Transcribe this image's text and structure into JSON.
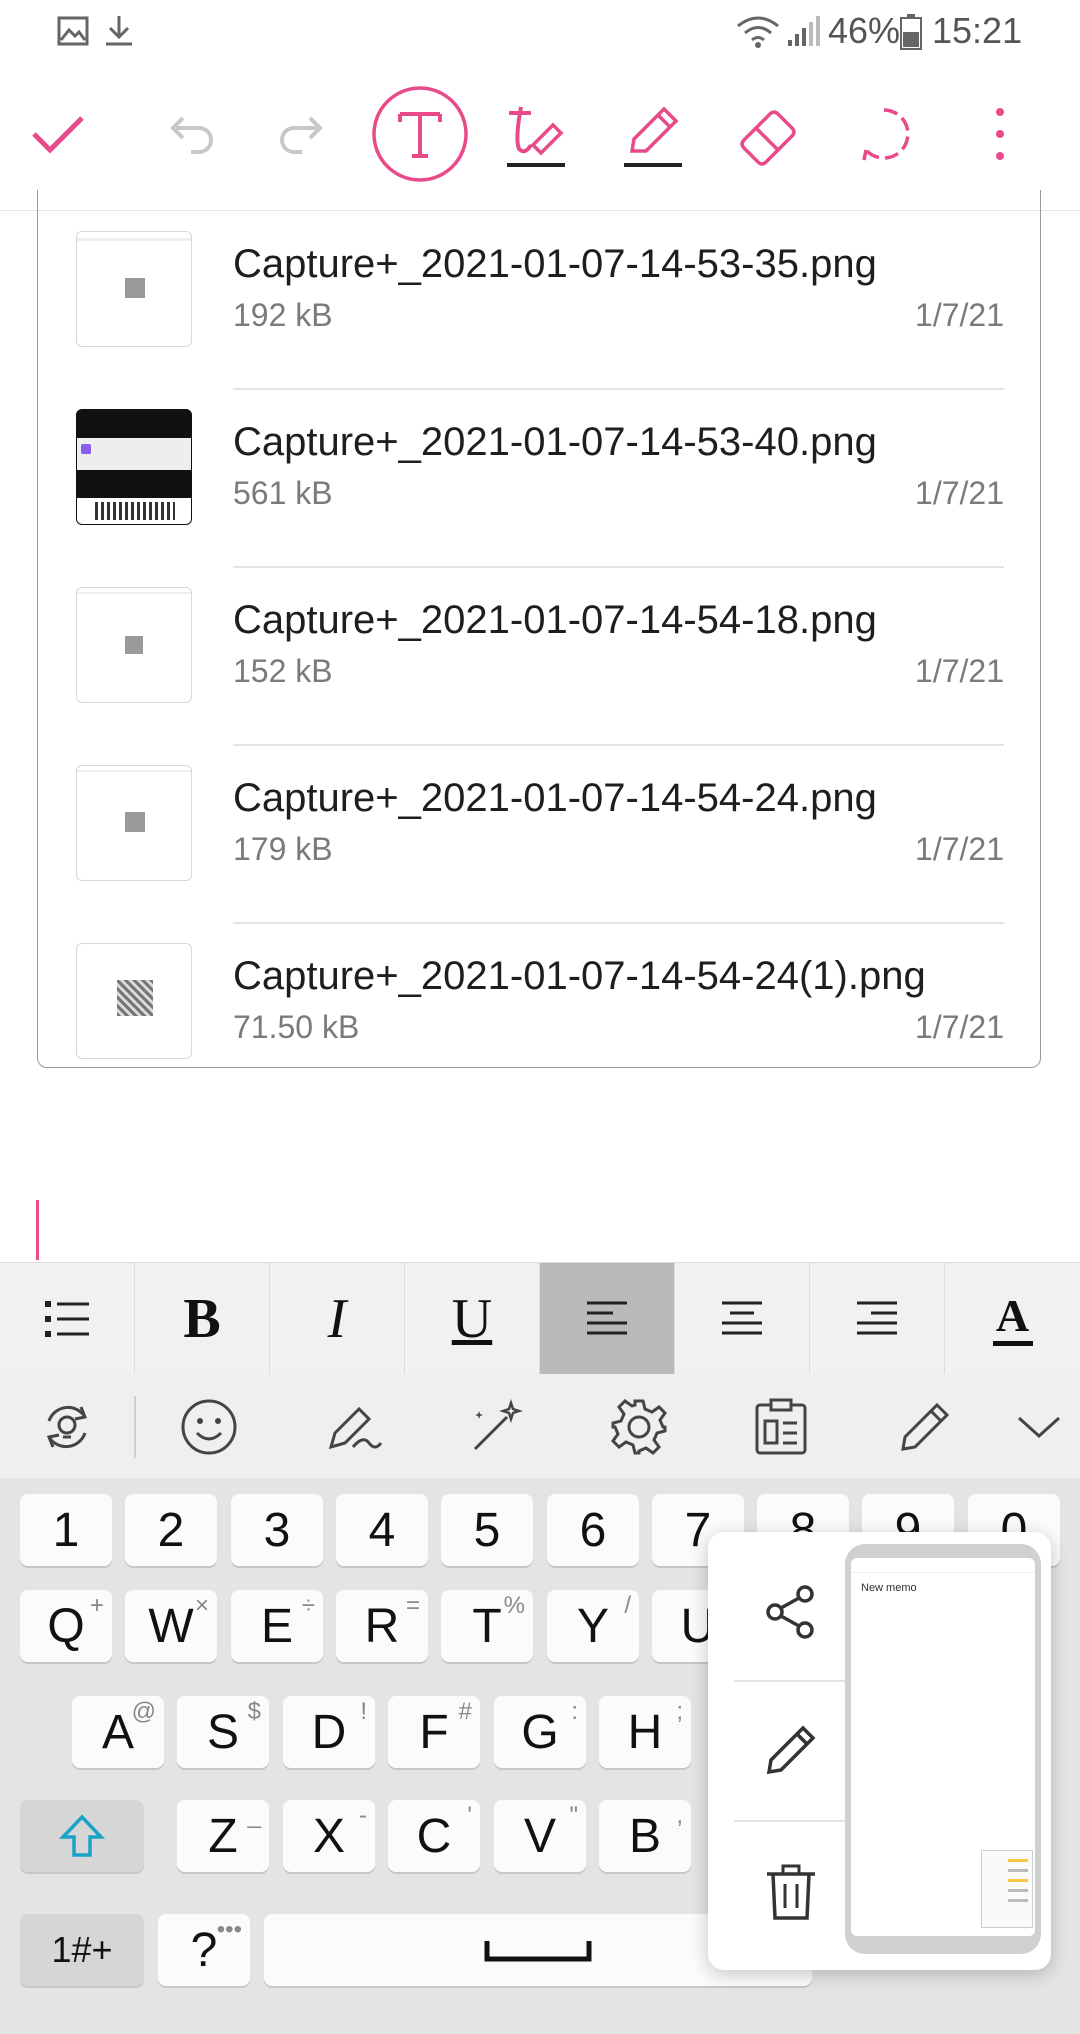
{
  "status_bar": {
    "battery": "46%",
    "time": "15:21",
    "icons": [
      "image-icon",
      "download-icon",
      "wifi-icon",
      "signal-icon",
      "battery-icon"
    ]
  },
  "toolbar": {
    "items": [
      "check-icon",
      "undo-icon",
      "redo-icon",
      "text-mode-icon",
      "handwriting-pen-icon",
      "pencil-icon",
      "eraser-icon",
      "lasso-select-icon",
      "more-icon"
    ]
  },
  "files": [
    {
      "name": "Capture+_2021-01-07-14-53-35.png",
      "size": "192 kB",
      "date": "1/7/21"
    },
    {
      "name": "Capture+_2021-01-07-14-53-40.png",
      "size": "561 kB",
      "date": "1/7/21"
    },
    {
      "name": "Capture+_2021-01-07-14-54-18.png",
      "size": "152 kB",
      "date": "1/7/21"
    },
    {
      "name": "Capture+_2021-01-07-14-54-24.png",
      "size": "179 kB",
      "date": "1/7/21"
    },
    {
      "name": "Capture+_2021-01-07-14-54-24(1).png",
      "size": "71.50 kB",
      "date": "1/7/21"
    }
  ],
  "format_bar": {
    "bold": "B",
    "italic": "I",
    "underline": "U",
    "font": "A"
  },
  "keyboard": {
    "numbers": [
      "1",
      "2",
      "3",
      "4",
      "5",
      "6",
      "7",
      "8",
      "9",
      "0"
    ],
    "row1": [
      {
        "k": "Q",
        "s": "+"
      },
      {
        "k": "W",
        "s": "×"
      },
      {
        "k": "E",
        "s": "÷"
      },
      {
        "k": "R",
        "s": "="
      },
      {
        "k": "T",
        "s": "%"
      },
      {
        "k": "Y",
        "s": "/"
      },
      {
        "k": "U",
        "s": ""
      }
    ],
    "row2": [
      {
        "k": "A",
        "s": "@"
      },
      {
        "k": "S",
        "s": "$"
      },
      {
        "k": "D",
        "s": "!"
      },
      {
        "k": "F",
        "s": "#"
      },
      {
        "k": "G",
        "s": ":"
      },
      {
        "k": "H",
        "s": ";"
      }
    ],
    "row3": [
      {
        "k": "Z",
        "s": "_"
      },
      {
        "k": "X",
        "s": "-"
      },
      {
        "k": "C",
        "s": "'"
      },
      {
        "k": "V",
        "s": "\""
      },
      {
        "k": "B",
        "s": ","
      }
    ],
    "symbols_key": "1#+",
    "question_key": "?",
    "question_sup": "•••"
  },
  "popup": {
    "preview_title": "New memo"
  },
  "colors": {
    "accent": "#e94b8a",
    "format_active": "#b9b9b9"
  }
}
